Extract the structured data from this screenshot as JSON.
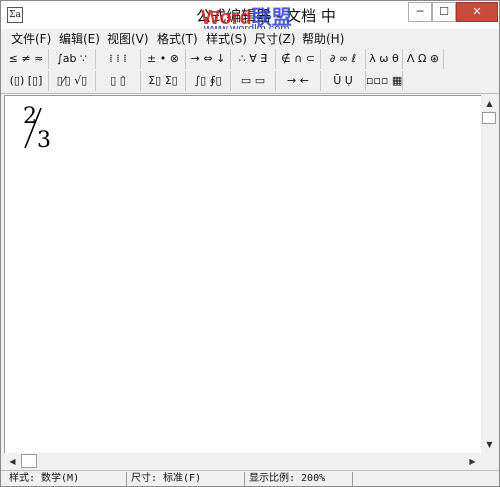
{
  "window": {
    "title": "公式编辑器 - 文档 中",
    "app_icon_glyph": "Σa",
    "min_glyph": "─",
    "max_glyph": "☐",
    "close_glyph": "✕"
  },
  "watermark": {
    "part1": "Word",
    "part2": "联盟",
    "url": "www.wordlm.com"
  },
  "menu": [
    {
      "label": "文件(F)"
    },
    {
      "label": "编辑(E)"
    },
    {
      "label": "视图(V)"
    },
    {
      "label": "格式(T)"
    },
    {
      "label": "样式(S)"
    },
    {
      "label": "尺寸(Z)"
    },
    {
      "label": "帮助(H)"
    }
  ],
  "toolbar_row1": [
    {
      "glyph": "≤ ≠ ≈",
      "icon": "relations-palette-icon"
    },
    {
      "glyph": "∫ab ∵",
      "icon": "spaces-ellipses-icon"
    },
    {
      "glyph": "⁞ ⁞ ⁞",
      "icon": "embellishments-icon"
    },
    {
      "glyph": "± • ⊗",
      "icon": "operators-palette-icon"
    },
    {
      "glyph": "→ ⇔ ↓",
      "icon": "arrows-palette-icon"
    },
    {
      "glyph": "∴ ∀ ∃",
      "icon": "logic-palette-icon"
    },
    {
      "glyph": "∉ ∩ ⊂",
      "icon": "sets-palette-icon"
    },
    {
      "glyph": "∂ ∞ ℓ",
      "icon": "misc-symbols-icon"
    },
    {
      "glyph": "λ ω θ",
      "icon": "greek-lower-icon"
    },
    {
      "glyph": "Λ Ω ⊛",
      "icon": "greek-upper-icon"
    }
  ],
  "toolbar_row2": [
    {
      "glyph": "(▯) [▯]",
      "icon": "fences-template-icon"
    },
    {
      "glyph": "▯⁄▯ √▯",
      "icon": "fraction-radical-icon"
    },
    {
      "glyph": "▯ ▯̇",
      "icon": "subscript-template-icon"
    },
    {
      "glyph": "Σ▯ Σ▯",
      "icon": "summation-template-icon"
    },
    {
      "glyph": "∫▯ ∮▯",
      "icon": "integral-template-icon"
    },
    {
      "glyph": "▭ ▭",
      "icon": "underbar-template-icon"
    },
    {
      "glyph": "→ ←",
      "icon": "labeled-arrow-icon"
    },
    {
      "glyph": "Ū Ụ",
      "icon": "products-template-icon"
    },
    {
      "glyph": "▫▫▫ ▦",
      "icon": "matrix-template-icon"
    }
  ],
  "editor": {
    "numerator": "2",
    "denominator": "3"
  },
  "scroll": {
    "up": "▲",
    "down": "▼",
    "left": "◀",
    "right": "▶"
  },
  "status": {
    "style": "样式: 数学(M)",
    "size": "尺寸: 标准(F)",
    "zoom": "显示比例: 200%"
  }
}
